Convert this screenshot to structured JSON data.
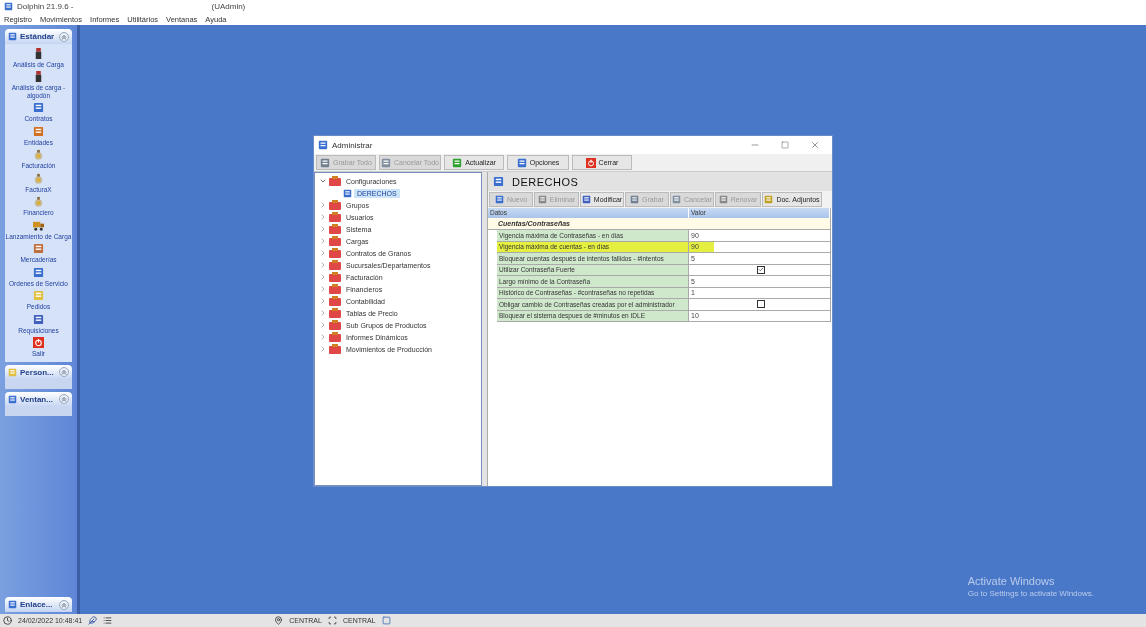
{
  "app_title": {
    "name": "Dolphin 21.9.6 -",
    "user": "(UAdmin)"
  },
  "menu": [
    "Registro",
    "Movimientos",
    "Informes",
    "Utilitários",
    "Ventanas",
    "Ayuda"
  ],
  "sidebar": {
    "groups": [
      {
        "title": "Estándar",
        "expanded": true,
        "items": [
          {
            "label": "Análisis de Carga"
          },
          {
            "label": "Análisis de carga - algodón"
          },
          {
            "label": "Contratos"
          },
          {
            "label": "Entidades"
          },
          {
            "label": "Facturación"
          },
          {
            "label": "FacturaX"
          },
          {
            "label": "Financiero"
          },
          {
            "label": "Lanzamiento de Carga"
          },
          {
            "label": "Mercaderías"
          },
          {
            "label": "Ordenes de Servicio"
          },
          {
            "label": "Pedidos"
          },
          {
            "label": "Requisiciones"
          },
          {
            "label": "Salir"
          }
        ]
      },
      {
        "title": "Person...",
        "expanded": false
      },
      {
        "title": "Ventan...",
        "expanded": false
      }
    ],
    "bottom_group": {
      "title": "Enlace..."
    }
  },
  "window": {
    "title": "Administrar",
    "toolbar": [
      {
        "label": "Grabar Todo",
        "disabled": true
      },
      {
        "label": "Cancelar Todo",
        "disabled": true
      },
      {
        "label": "Actualizar",
        "disabled": false
      },
      {
        "label": "Opciones",
        "disabled": false
      },
      {
        "label": "Cerrar",
        "disabled": false
      }
    ],
    "tree": [
      {
        "label": "Configuraciones",
        "expanded": true,
        "children": [
          {
            "label": "DERECHOS",
            "selected": true
          }
        ]
      },
      {
        "label": "Grupos",
        "expanded": false
      },
      {
        "label": "Usuarios",
        "expanded": false
      },
      {
        "label": "Sistema",
        "expanded": false
      },
      {
        "label": "Cargas",
        "expanded": false
      },
      {
        "label": "Contratos de Granos",
        "expanded": false
      },
      {
        "label": "Sucursales/Departamentos",
        "expanded": false
      },
      {
        "label": "Facturación",
        "expanded": false
      },
      {
        "label": "Financieros",
        "expanded": false
      },
      {
        "label": "Contabilidad",
        "expanded": false
      },
      {
        "label": "Tablas de Precio",
        "expanded": false
      },
      {
        "label": "Sub Grupos de Productos",
        "expanded": false
      },
      {
        "label": "Informes Dinámicos",
        "expanded": false
      },
      {
        "label": "Movimientos de Producción",
        "expanded": false
      }
    ],
    "panel_title": "DERECHOS",
    "panel_toolbar": [
      {
        "label": "Nuevo",
        "disabled": true
      },
      {
        "label": "Eliminar",
        "disabled": true
      },
      {
        "label": "Modificar",
        "disabled": false
      },
      {
        "label": "Grabar",
        "disabled": true
      },
      {
        "label": "Cancelar",
        "disabled": true
      },
      {
        "label": "Renovar",
        "disabled": true
      },
      {
        "label": "Doc. Adjuntos",
        "disabled": false
      }
    ],
    "grid": {
      "columns": [
        "Datos",
        "Valor"
      ],
      "group": "Cuentas/Contraseñas",
      "rows": [
        {
          "kind": "text",
          "label": "Vigencia máxima de Contraseñas - en días",
          "value": "90",
          "highlighted": false
        },
        {
          "kind": "text",
          "label": "Vigencia máxima de cuentas - en días",
          "value": "90",
          "highlighted": true
        },
        {
          "kind": "text",
          "label": "Bloquear cuentas después de intentos fallidos - #intentos",
          "value": "5",
          "highlighted": false
        },
        {
          "kind": "check",
          "label": "Utilizar Contraseña Fuerte",
          "checked": true,
          "highlighted": false
        },
        {
          "kind": "text",
          "label": "Largo mínimo de la Contraseña",
          "value": "5",
          "highlighted": false
        },
        {
          "kind": "text",
          "label": "Histórico de Contraseñas - #contraseñas no repetidas",
          "value": "1",
          "highlighted": false
        },
        {
          "kind": "check",
          "label": "Obligar cambio de Contraseñas creadas por el administrador",
          "checked": false,
          "highlighted": false
        },
        {
          "kind": "text",
          "label": "Bloquear el sistema despues de #minutos en IDLE",
          "value": "10",
          "highlighted": false
        }
      ]
    }
  },
  "activation": {
    "title": "Activate Windows",
    "subtitle": "Go to Settings to activate Windows."
  },
  "status_bar": {
    "datetime": "24/02/2022 10:48:41",
    "location_1": "CENTRAL",
    "location_2": "CENTRAL"
  }
}
